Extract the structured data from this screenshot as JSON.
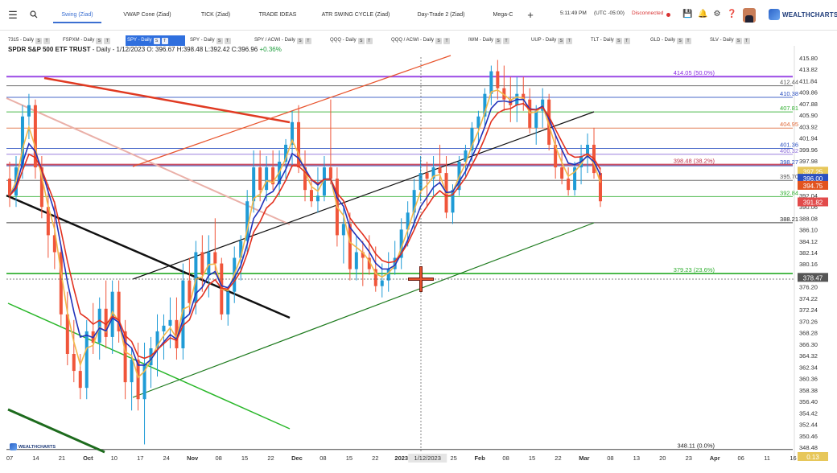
{
  "topbar": {
    "menu_icon": "hamburger-icon",
    "search_icon": "search-icon",
    "tabs": [
      {
        "label": "Swing (Ziad)",
        "active": true
      },
      {
        "label": "VWAP Cone (Ziad)",
        "active": false
      },
      {
        "label": "TICK (Ziad)",
        "active": false
      },
      {
        "label": "TRADE IDEAS",
        "active": false
      },
      {
        "label": "ATR SWING CYCLE (Ziad)",
        "active": false
      },
      {
        "label": "Day-Trade 2 (Ziad)",
        "active": false
      },
      {
        "label": "Mega-C",
        "active": false
      }
    ],
    "add_tab": "+",
    "time": "5:11:49 PM",
    "timezone": "(UTC -05:00)",
    "connection": "Disconnected",
    "logo": "WEALTHCHARTS"
  },
  "symbol_tabs": [
    {
      "label": "7315 - Daily"
    },
    {
      "label": "FSPXM - Daily"
    },
    {
      "label": "SPY - Daily",
      "active": true
    },
    {
      "label": "SPY - Daily"
    },
    {
      "label": "SPY / ACWI - Daily"
    },
    {
      "label": "QQQ - Daily"
    },
    {
      "label": "QQQ / ACWI - Daily"
    },
    {
      "label": "IWM - Daily"
    },
    {
      "label": "UUP - Daily"
    },
    {
      "label": "TLT - Daily"
    },
    {
      "label": "GLD - Daily"
    },
    {
      "label": "SLV - Daily"
    }
  ],
  "chart": {
    "symbol": "SPDR S&P 500 ETF TRUST",
    "interval": " - Daily - 1/12/2023",
    "ohlc": " O: 396.67 H:398.48 L:392.42 C:396.96",
    "change": " +0.36%",
    "bottom_logo": "WEALTHCHARTS"
  },
  "chart_data": {
    "type": "candlestick",
    "y_axis_ticks": [
      "415.80",
      "413.82",
      "411.84",
      "409.86",
      "407.88",
      "405.90",
      "403.92",
      "401.94",
      "399.96",
      "397.98",
      "396.00",
      "394.02",
      "392.04",
      "390.06",
      "388.08",
      "386.10",
      "384.12",
      "382.14",
      "380.16",
      "378.18",
      "376.20",
      "374.22",
      "372.24",
      "370.26",
      "368.28",
      "366.30",
      "364.32",
      "362.34",
      "360.36",
      "358.38",
      "356.40",
      "354.42",
      "352.44",
      "350.46",
      "348.48"
    ],
    "x_axis_labels": [
      "07",
      "14",
      "21",
      "Oct",
      "10",
      "17",
      "24",
      "Nov",
      "08",
      "15",
      "22",
      "Dec",
      "08",
      "15",
      "22",
      "2023",
      "1/12/2023",
      "25",
      "Feb",
      "08",
      "15",
      "22",
      "Mar",
      "08",
      "13",
      "20",
      "23",
      "Apr",
      "06",
      "11",
      "16",
      "20"
    ],
    "ylim": [
      347.5,
      417.5
    ],
    "levels": [
      {
        "label": "414.05 (50.0%)",
        "value": 414.05,
        "color": "#8a2be2"
      },
      {
        "label": "412.44",
        "value": 412.44,
        "color": "#555555"
      },
      {
        "label": "410.38",
        "value": 410.38,
        "color": "#2a4fc0"
      },
      {
        "label": "407.81",
        "value": 407.81,
        "color": "#2fae2f"
      },
      {
        "label": "404.95",
        "value": 404.95,
        "color": "#e06a3a"
      },
      {
        "label": "401.36",
        "value": 401.36,
        "color": "#2a4fc0"
      },
      {
        "label": "400.32",
        "value": 400.32,
        "color": "#8a6ad8"
      },
      {
        "label": "398.48 (38.2%)",
        "value": 398.48,
        "color": "#c0304a"
      },
      {
        "label": "398.27",
        "value": 398.27,
        "color": "#2a4fc0"
      },
      {
        "label": "395.70",
        "value": 395.7,
        "color": "#555555"
      },
      {
        "label": "392.84",
        "value": 392.84,
        "color": "#2fae2f"
      },
      {
        "label": "388.21",
        "value": 388.21,
        "color": "#222222"
      },
      {
        "label": "379.23 (23.6%)",
        "value": 379.23,
        "color": "#2fae2f"
      },
      {
        "label": "348.11 (0.0%)",
        "value": 348.11,
        "color": "#222222"
      }
    ],
    "price_tags": [
      {
        "label": "397.25",
        "value": 397.25,
        "color": "#e7c75a"
      },
      {
        "label": "396.00",
        "value": 396.0,
        "color": "#2a4fc0"
      },
      {
        "label": "394.75",
        "value": 394.75,
        "color": "#e2531f"
      },
      {
        "label": "391.82",
        "value": 391.82,
        "color": "#e24b4b"
      },
      {
        "label": "378.47",
        "value": 378.47,
        "color": "#555555"
      },
      {
        "label": "0.13",
        "value": 348.0,
        "color": "#e7c75a"
      }
    ],
    "candles": [
      [
        396,
        399,
        391,
        393
      ],
      [
        393,
        400,
        391,
        398
      ],
      [
        398,
        409,
        396,
        407
      ],
      [
        407,
        411,
        403,
        409
      ],
      [
        409,
        410,
        396,
        398
      ],
      [
        398,
        400,
        389,
        391
      ],
      [
        391,
        395,
        382,
        386
      ],
      [
        386,
        392,
        380,
        383
      ],
      [
        383,
        384,
        370,
        372
      ],
      [
        372,
        376,
        363,
        365
      ],
      [
        365,
        371,
        360,
        362
      ],
      [
        362,
        365,
        357,
        359
      ],
      [
        359,
        371,
        357,
        369
      ],
      [
        369,
        374,
        365,
        367
      ],
      [
        367,
        375,
        364,
        373
      ],
      [
        373,
        378,
        366,
        368
      ],
      [
        368,
        378,
        365,
        376
      ],
      [
        376,
        378,
        367,
        369
      ],
      [
        369,
        371,
        357,
        360
      ],
      [
        360,
        366,
        355,
        364
      ],
      [
        364,
        367,
        355,
        357
      ],
      [
        357,
        367,
        349,
        363
      ],
      [
        363,
        368,
        359,
        366
      ],
      [
        366,
        372,
        361,
        369
      ],
      [
        369,
        372,
        364,
        370
      ],
      [
        370,
        375,
        366,
        371
      ],
      [
        371,
        375,
        364,
        366
      ],
      [
        366,
        381,
        364,
        378
      ],
      [
        378,
        382,
        372,
        374
      ],
      [
        374,
        385,
        372,
        383
      ],
      [
        383,
        386,
        376,
        379
      ],
      [
        379,
        386,
        375,
        383
      ],
      [
        383,
        389,
        379,
        381
      ],
      [
        381,
        382,
        371,
        372
      ],
      [
        372,
        377,
        370,
        376
      ],
      [
        376,
        384,
        374,
        382
      ],
      [
        382,
        386,
        378,
        385
      ],
      [
        385,
        394,
        383,
        392
      ],
      [
        392,
        401,
        390,
        398
      ],
      [
        398,
        401,
        392,
        394
      ],
      [
        394,
        400,
        392,
        398
      ],
      [
        398,
        401,
        394,
        395
      ],
      [
        395,
        401,
        393,
        399
      ],
      [
        399,
        403,
        396,
        402
      ],
      [
        402,
        408,
        398,
        406
      ],
      [
        406,
        409,
        397,
        398
      ],
      [
        398,
        401,
        392,
        394
      ],
      [
        394,
        396,
        391,
        392
      ],
      [
        392,
        398,
        390,
        393
      ],
      [
        393,
        400,
        392,
        398
      ],
      [
        398,
        410,
        395,
        396
      ],
      [
        396,
        398,
        384,
        386
      ],
      [
        386,
        391,
        381,
        388
      ],
      [
        388,
        390,
        378,
        380
      ],
      [
        380,
        386,
        378,
        383
      ],
      [
        383,
        385,
        377,
        382
      ],
      [
        382,
        386,
        379,
        380
      ],
      [
        380,
        384,
        376,
        377
      ],
      [
        377,
        381,
        375,
        378
      ],
      [
        378,
        383,
        376,
        380
      ],
      [
        380,
        385,
        379,
        382
      ],
      [
        382,
        389,
        380,
        387
      ],
      [
        387,
        392,
        384,
        390
      ],
      [
        390,
        396,
        387,
        394
      ],
      [
        394,
        400,
        392,
        397
      ],
      [
        397,
        399,
        391,
        396
      ],
      [
        396,
        400,
        393,
        398
      ],
      [
        398,
        402,
        395,
        397
      ],
      [
        397,
        400,
        389,
        390
      ],
      [
        390,
        395,
        388,
        394
      ],
      [
        394,
        400,
        393,
        399
      ],
      [
        399,
        402,
        396,
        401
      ],
      [
        401,
        406,
        399,
        405
      ],
      [
        405,
        408,
        402,
        407
      ],
      [
        407,
        412,
        405,
        411
      ],
      [
        411,
        416,
        409,
        415
      ],
      [
        415,
        417,
        410,
        412
      ],
      [
        412,
        416,
        408,
        410
      ],
      [
        410,
        414,
        406,
        409
      ],
      [
        409,
        414,
        406,
        411
      ],
      [
        411,
        414,
        408,
        410
      ],
      [
        410,
        412,
        404,
        405
      ],
      [
        405,
        409,
        402,
        408
      ],
      [
        408,
        412,
        405,
        410
      ],
      [
        410,
        411,
        401,
        402
      ],
      [
        402,
        404,
        396,
        398
      ],
      [
        398,
        401,
        395,
        396
      ],
      [
        396,
        398,
        393,
        394
      ],
      [
        394,
        399,
        393,
        398
      ],
      [
        398,
        402,
        395,
        400
      ],
      [
        400,
        404,
        397,
        402
      ],
      [
        402,
        405,
        396,
        397
      ],
      [
        397,
        398,
        391,
        392
      ]
    ]
  }
}
